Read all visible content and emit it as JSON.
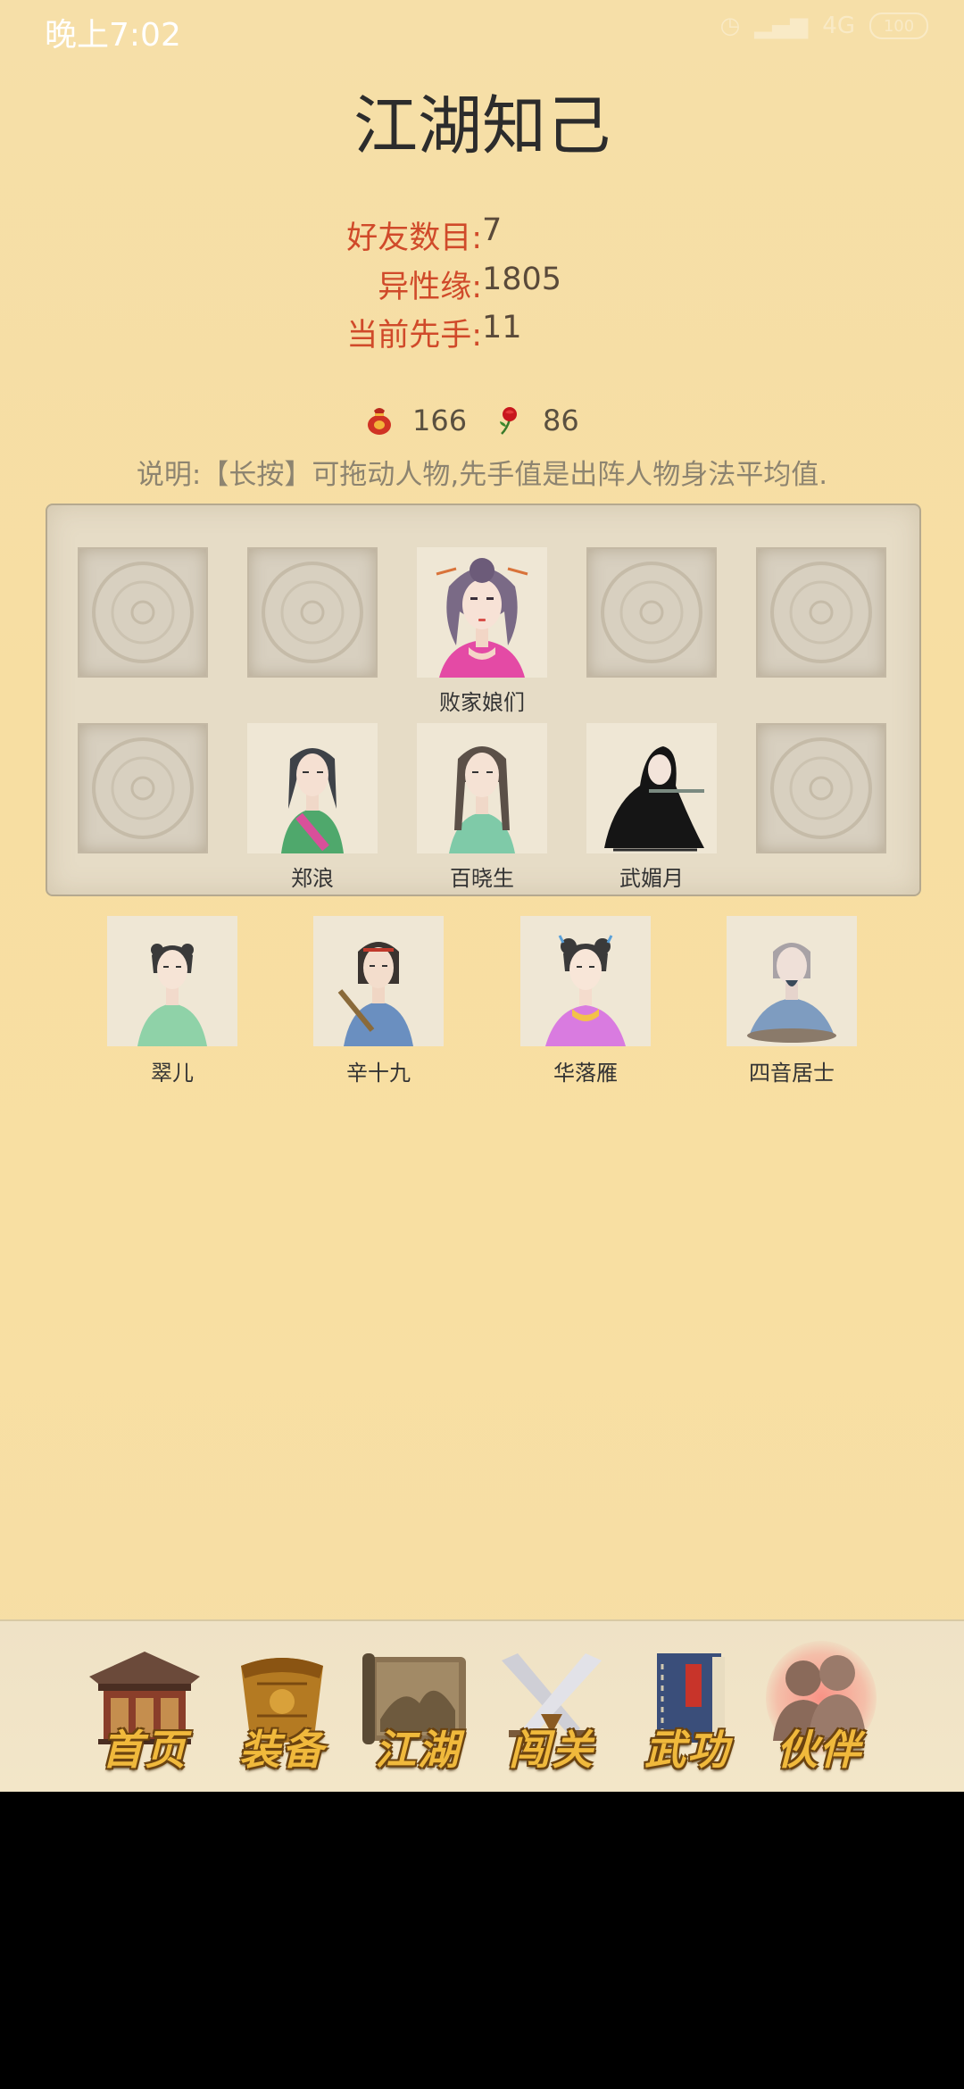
{
  "status_bar": {
    "time": "晚上7:02",
    "battery": "100"
  },
  "title": "江湖知己",
  "stats": [
    {
      "label": "好友数目:",
      "value": "7"
    },
    {
      "label": "异性缘:",
      "value": "1805"
    },
    {
      "label": "当前先手:",
      "value": "11"
    }
  ],
  "resources": {
    "item1": {
      "icon": "red-pouch-icon",
      "count": "166"
    },
    "item2": {
      "icon": "rose-icon",
      "count": "86"
    }
  },
  "instructions": "说明:【长按】可拖动人物,先手值是出阵人物身法平均值.",
  "formation": {
    "row1": [
      {
        "name": "",
        "empty": true
      },
      {
        "name": "",
        "empty": true
      },
      {
        "name": "败家娘们",
        "empty": false
      },
      {
        "name": "",
        "empty": true
      },
      {
        "name": "",
        "empty": true
      }
    ],
    "row2": [
      {
        "name": "",
        "empty": true
      },
      {
        "name": "郑浪",
        "empty": false
      },
      {
        "name": "百晓生",
        "empty": false
      },
      {
        "name": "武媚月",
        "empty": false
      },
      {
        "name": "",
        "empty": true
      }
    ]
  },
  "companions": [
    {
      "name": "翠儿"
    },
    {
      "name": "辛十九"
    },
    {
      "name": "华落雁"
    },
    {
      "name": "四音居士"
    }
  ],
  "nav": {
    "items": [
      {
        "label": "首页",
        "icon": "house-icon"
      },
      {
        "label": "装备",
        "icon": "armor-icon"
      },
      {
        "label": "江湖",
        "icon": "scroll-icon"
      },
      {
        "label": "闯关",
        "icon": "crossed-swords-icon"
      },
      {
        "label": "武功",
        "icon": "book-icon"
      },
      {
        "label": "伙伴",
        "icon": "partners-icon"
      }
    ],
    "active": "伙伴"
  },
  "colors": {
    "label_red": "#d04a2a",
    "background": "#f6dfa8",
    "nav_gold": "#f0b93c"
  }
}
